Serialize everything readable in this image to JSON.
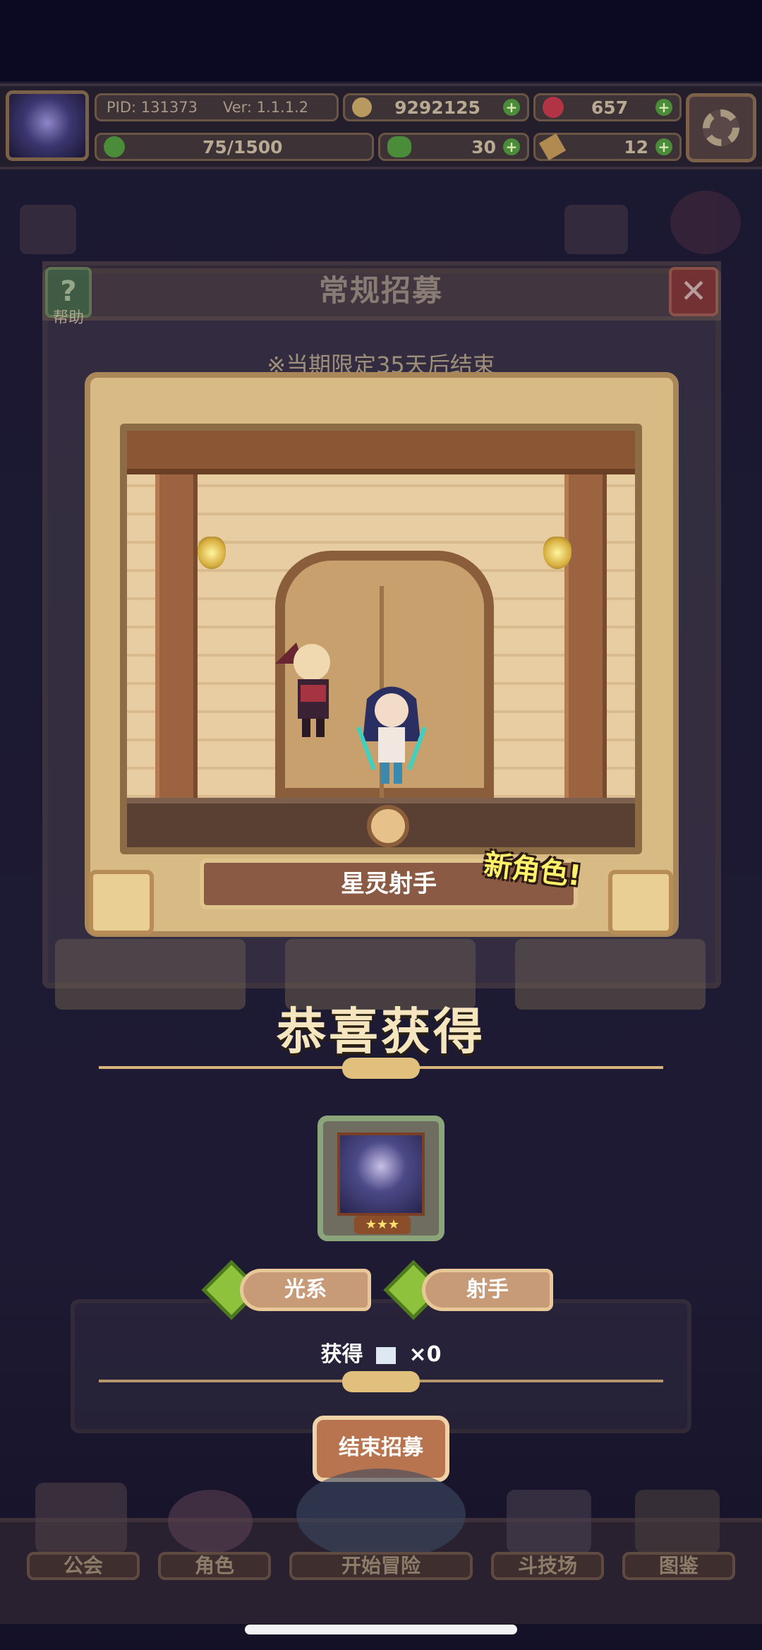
{
  "hud": {
    "pid_label": "PID: 131373",
    "version_label": "Ver: 1.1.1.2",
    "gold": "9292125",
    "gems": "657",
    "stamina": "75/1500",
    "clover": "30",
    "key": "12"
  },
  "panel": {
    "title": "常规招募",
    "help_label": "帮助",
    "help_glyph": "?",
    "close_glyph": "✕",
    "notice": "※当期限定35天后结束"
  },
  "reveal": {
    "character_name": "星灵射手",
    "new_tag": "新角色!",
    "congrats": "恭喜获得",
    "stars": "★★★",
    "element": "光系",
    "role": "射手",
    "obtain_label": "获得",
    "obtain_count": "×0",
    "end_button": "结束招募"
  },
  "nav": {
    "items": [
      "公会",
      "角色",
      "开始冒险",
      "斗技场",
      "图鉴"
    ]
  },
  "colors": {
    "gold_text": "#f6e6c0",
    "new_tag": "#fff16a",
    "panel_wood": "#8a5a44"
  }
}
